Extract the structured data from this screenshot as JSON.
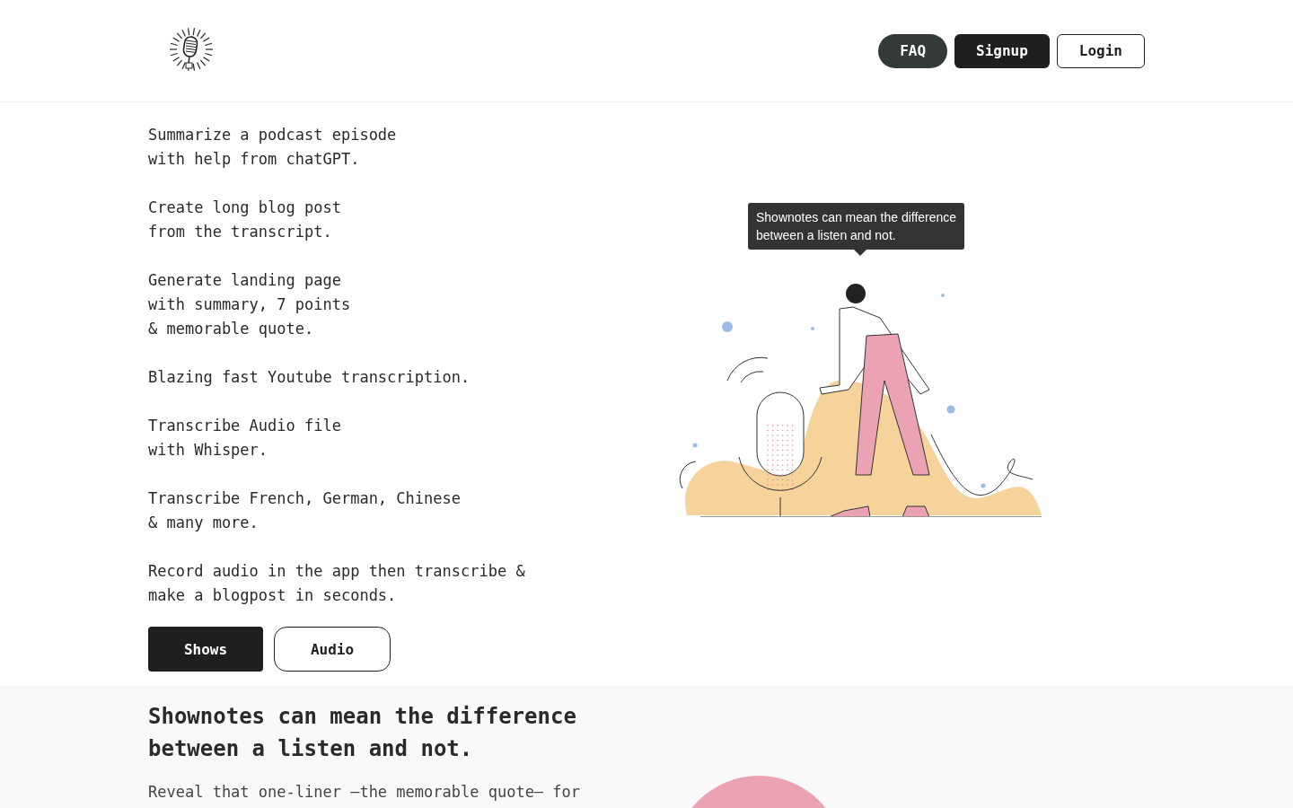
{
  "header": {
    "nav": [
      {
        "label": "FAQ",
        "kind": "pill"
      },
      {
        "label": "Signup",
        "kind": "solid"
      },
      {
        "label": "Login",
        "kind": "outline"
      }
    ]
  },
  "features": [
    {
      "lines": [
        "Summarize a podcast episode",
        "with help from chatGPT."
      ]
    },
    {
      "lines": [
        "Create long blog post",
        "from the transcript."
      ]
    },
    {
      "lines": [
        "Generate landing page",
        "with summary, 7 points",
        "& memorable quote."
      ]
    },
    {
      "lines": [
        "Blazing fast Youtube transcription."
      ]
    },
    {
      "lines": [
        "Transcribe Audio file",
        "with Whisper."
      ]
    },
    {
      "lines": [
        "Transcribe French, German, Chinese",
        "& many more."
      ]
    },
    {
      "lines": [
        "Record audio in the app then transcribe &",
        "make a blogpost in seconds."
      ]
    }
  ],
  "actions": [
    {
      "label": "Shows",
      "kind": "solid"
    },
    {
      "label": "Audio",
      "kind": "outline"
    }
  ],
  "tooltip": {
    "lines": [
      "Shownotes can mean the difference",
      "between a listen and not."
    ]
  },
  "section": {
    "heading_lines": [
      "Shownotes can mean the difference",
      "between a listen and not."
    ],
    "text": "Reveal that one-liner —the memorable quote— for"
  }
}
